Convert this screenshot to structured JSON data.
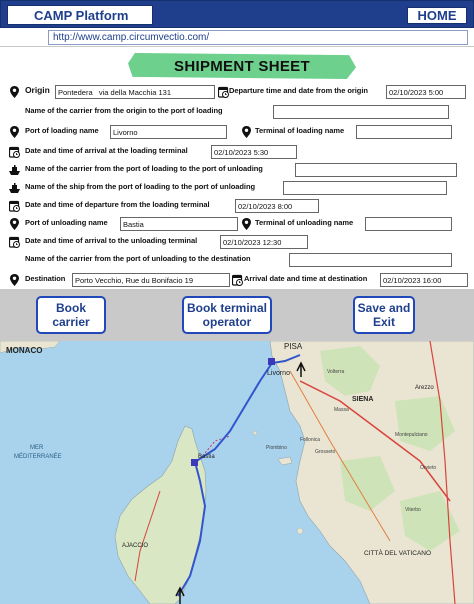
{
  "header": {
    "app_title": "CAMP Platform",
    "home_label": "HOME",
    "url": "http://www.camp.circumvectio.com/"
  },
  "form": {
    "title": "SHIPMENT SHEET",
    "origin": {
      "label": "Origin",
      "value": "Pontedera   via della Macchia 131"
    },
    "departure_origin": {
      "label": "Departure time and date from the origin",
      "value": "02/10/2023 5:00"
    },
    "carrier_origin_to_loading": {
      "label": "Name of the carrier from the origin to the port of loading",
      "value": ""
    },
    "port_of_loading": {
      "label": "Port of loading name",
      "value": "Livorno"
    },
    "terminal_of_loading": {
      "label": "Terminal of loading name",
      "value": ""
    },
    "arrival_loading_terminal": {
      "label": "Date and time of arrival at the loading terminal",
      "value": "02/10/2023 5:30"
    },
    "carrier_loading_to_unloading": {
      "label": "Name of the carrier from the port of loading to the port of unloading",
      "value": ""
    },
    "ship_name": {
      "label": "Name of the ship from the port of loading to the port of unloading",
      "value": ""
    },
    "departure_loading_terminal": {
      "label": "Date and time of departure from the loading terminal",
      "value": "02/10/2023 8:00"
    },
    "port_of_unloading": {
      "label": "Port of unloading name",
      "value": "Bastia"
    },
    "terminal_of_unloading": {
      "label": "Terminal of unloading name",
      "value": ""
    },
    "arrival_unloading_terminal": {
      "label": "Date and time of arrival to the unloading terminal",
      "value": "02/10/2023 12:30"
    },
    "carrier_unloading_to_destination": {
      "label": "Name of the carrier from the port of unloading to the destination",
      "value": ""
    },
    "destination": {
      "label": "Destination",
      "value": "Porto Vecchio, Rue du Bonifacio 19"
    },
    "arrival_destination": {
      "label": "Arrival date and time at destination",
      "value": "02/10/2023 16:00"
    }
  },
  "actions": {
    "book_carrier": "Book carrier",
    "book_terminal_operator": "Book terminal operator",
    "save_exit": "Save and Exit"
  },
  "map": {
    "labels": {
      "monaco": "MONACO",
      "mer": "MER",
      "mediterranee": "MÉDITERRANÉE",
      "pisa": "PISA",
      "livorno": "Livorno",
      "siena": "SIENA",
      "arezzo": "Arezzo",
      "bastia": "Bastia",
      "ajaccio": "AJACCIO",
      "citta_vaticano": "CITTÀ DEL VATICANO",
      "grosseto": "Grosseto",
      "montepulciano": "Montepulciano",
      "orvieto": "Orvieto",
      "viterbo": "Viterbo",
      "follonica": "Follonica",
      "piombino": "Piombino",
      "volterra": "Volterra",
      "massa": "Massa"
    }
  },
  "colors": {
    "header_blue": "#1f3f8c",
    "banner_green": "#6dd08c",
    "button_border": "#2048b8",
    "route_blue": "#3355cc",
    "sea": "#a9d3ec",
    "land": "#eae5d3"
  }
}
